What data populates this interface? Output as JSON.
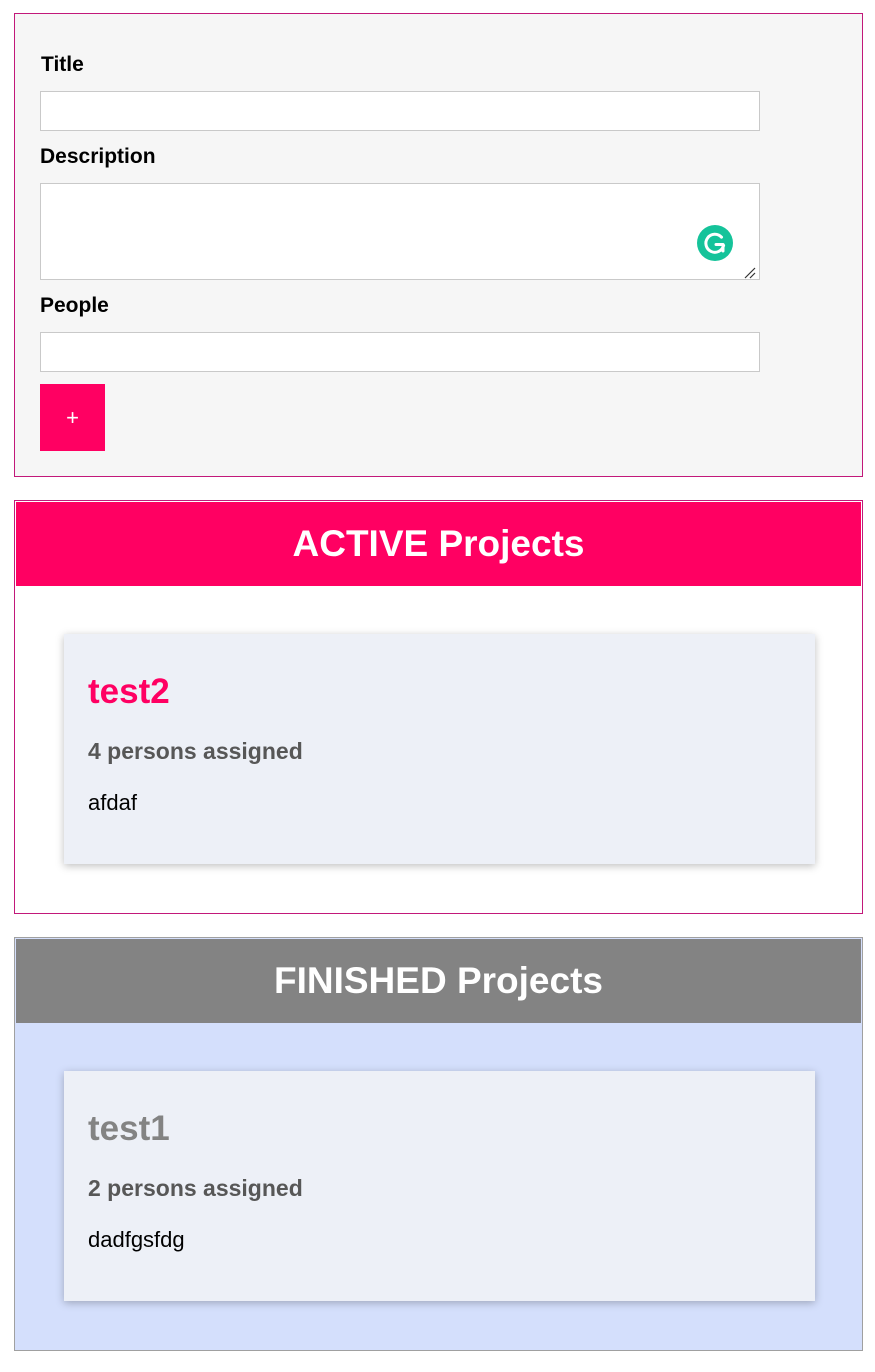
{
  "form": {
    "title_label": "Title",
    "title_value": "",
    "description_label": "Description",
    "description_value": "",
    "people_label": "People",
    "people_value": "",
    "submit_label": "+"
  },
  "active_list": {
    "heading": "ACTIVE Projects",
    "projects": [
      {
        "title": "test2",
        "persons": "4 persons assigned",
        "description": "afdaf"
      }
    ]
  },
  "finished_list": {
    "heading": "FINISHED Projects",
    "projects": [
      {
        "title": "test1",
        "persons": "2 persons assigned",
        "description": "dadfgsfdg"
      }
    ]
  },
  "icons": {
    "grammarly": "grammarly-icon",
    "resize": "resize-grip-icon"
  },
  "colors": {
    "accent": "#ff0062",
    "finished_header": "#838383",
    "finished_bg": "#d4dffc",
    "card_bg": "#edf0f7",
    "form_bg": "#f6f6f6",
    "grammarly": "#15c39a"
  }
}
